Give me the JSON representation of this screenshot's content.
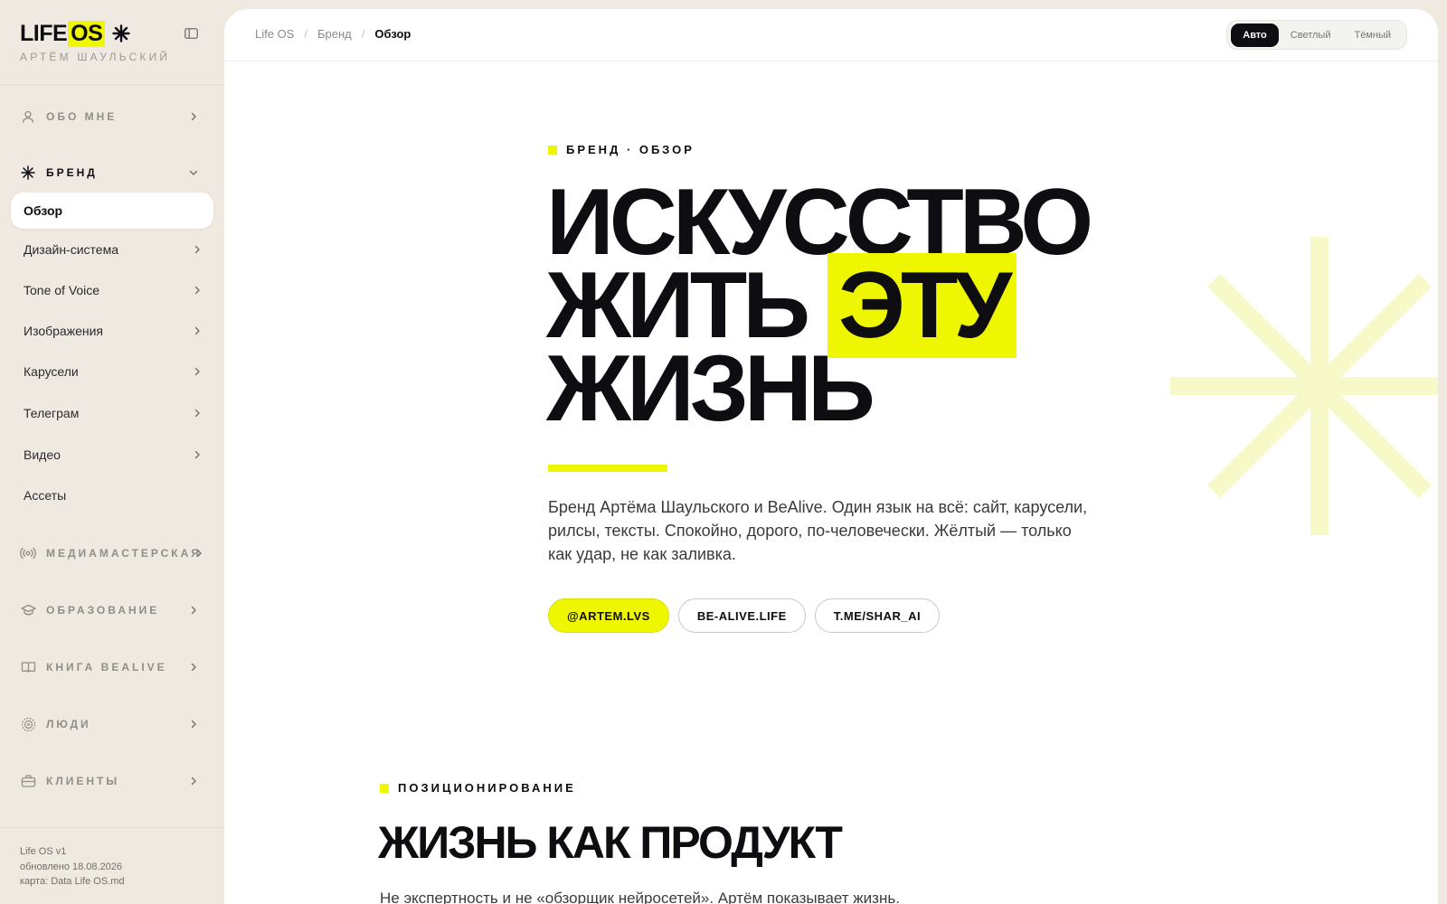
{
  "sidebar": {
    "logo_life": "LIFE",
    "logo_os": "OS",
    "owner": "АРТЁМ ШАУЛЬСКИЙ",
    "sections": [
      {
        "label": "ОБО МНЕ",
        "icon": "user-icon"
      },
      {
        "label": "БРЕНД",
        "icon": "asterisk-icon"
      },
      {
        "label": "МЕДИАМАСТЕРСКАЯ",
        "icon": "broadcast-icon"
      },
      {
        "label": "ОБРАЗОВАНИЕ",
        "icon": "graduation-cap-icon"
      },
      {
        "label": "КНИГА BEALIVE",
        "icon": "book-icon"
      },
      {
        "label": "ЛЮДИ",
        "icon": "people-icon"
      },
      {
        "label": "КЛИЕНТЫ",
        "icon": "briefcase-icon"
      }
    ],
    "brand_items": [
      {
        "label": "Обзор"
      },
      {
        "label": "Дизайн-система"
      },
      {
        "label": "Tone of Voice"
      },
      {
        "label": "Изображения"
      },
      {
        "label": "Карусели"
      },
      {
        "label": "Телеграм"
      },
      {
        "label": "Видео"
      },
      {
        "label": "Ассеты"
      }
    ],
    "footer": {
      "version": "Life OS v1",
      "updated": "обновлено 18.08.2026",
      "map": "карта: Data Life OS.md"
    }
  },
  "topbar": {
    "breadcrumbs": [
      "Life OS",
      "Бренд",
      "Обзор"
    ],
    "theme_options": [
      "Авто",
      "Светлый",
      "Тёмный"
    ],
    "theme_selected": "Авто"
  },
  "hero": {
    "kicker": "БРЕНД · ОБЗОР",
    "title_line1": "ИСКУССТВО",
    "title_line2_start": "ЖИТЬ",
    "title_line2_highlight": "ЭТУ",
    "title_line3": "ЖИЗНЬ",
    "description": "Бренд Артёма Шаульского и BeAlive. Один язык на всё: сайт, карусели, рилсы, тексты. Спокойно, дорого, по-человечески. Жёлтый — только как удар, не как заливка.",
    "links": [
      "@ARTEM.LVS",
      "BE-ALIVE.LIFE",
      "T.ME/SHAR_AI"
    ]
  },
  "positioning": {
    "kicker": "ПОЗИЦИОНИРОВАНИЕ",
    "title": "ЖИЗНЬ КАК ПРОДУКТ",
    "text": "Не экспертность и не «обзорщик нейросетей». Артём показывает жизнь."
  },
  "colors": {
    "accent": "#eef600",
    "ink": "#0d0d12",
    "sidebar_bg": "#efe9e1",
    "main_bg": "#ffffff"
  }
}
